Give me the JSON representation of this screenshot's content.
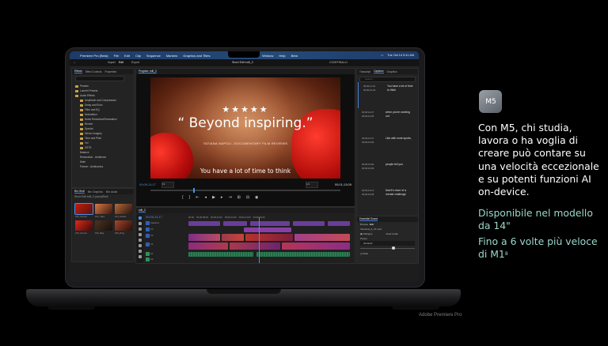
{
  "menubar": {
    "app": "Premiere Pro (Beta)",
    "items": [
      "File",
      "Edit",
      "Clip",
      "Sequence",
      "Markers",
      "Graphics and Titles",
      "View",
      "Window",
      "Help",
      "Beta"
    ],
    "clock": "Tue Oct 14  9:41 AM"
  },
  "app_header": {
    "tabs": [
      "Import",
      "Edit",
      "Export"
    ],
    "title": "Short Edit edit_3",
    "right": "CODEFINALv1"
  },
  "effects_panel": {
    "tabs": [
      "Effects",
      "Effect Controls",
      "Properties"
    ],
    "tree": [
      "Presets",
      "Lumetri Presets",
      "Audio Effects",
      "Amplitude and Compression",
      "Delay and Echo",
      "Filter and EQ",
      "Modulation",
      "Noise Reduction/Restoration",
      "Reverb",
      "Special",
      "Stereo Imagery",
      "Time and Pitch",
      "Vol",
      "VSTS",
      "Balance",
      "Restoration - Ambience",
      "Mute",
      "Panner - Ambisonics"
    ]
  },
  "bin_panel": {
    "tabs": [
      "Bin: Broll",
      "Bin: Graphics",
      "Bin: Audio"
    ],
    "path": "Short Edit edit_3 prproj/Broll",
    "clips": [
      "100_Gloves",
      "102_Tape",
      "104_Hands",
      "105_Gloves",
      "106_Bag",
      "109_Ring"
    ]
  },
  "program_monitor": {
    "title": "Program: edit_3",
    "stars": "★★★★★",
    "quote": "“ Beyond inspiring.”",
    "reviewer": "TATIANA NAPOLI, DOCUMENTARY FILM REVIEWS",
    "caption": "You have a lot of time to think",
    "timecode_left": "00;00;11;17",
    "fit": "Fit",
    "zoom": "1/2",
    "timecode_right": "00;01;13;09"
  },
  "captions_panel": {
    "tabs": [
      "Text",
      "Transcript",
      "Captions",
      "Graphics",
      "Sel"
    ],
    "search_placeholder": "Search",
    "items": [
      {
        "in": "00;00;11;15",
        "out": "00;00;12;23",
        "text": "You have a lot of time to think"
      },
      {
        "in": "00;00;12;27",
        "out": "00;00;14;25",
        "text": "when you're working out"
      },
      {
        "in": "00;00;14;27",
        "out": "00;00;15;00",
        "text": "Like with most sports,"
      },
      {
        "in": "00;00;15;00",
        "out": "00;00;16;09",
        "text": "people tell you"
      },
      {
        "in": "00;00;16;14",
        "out": "00;00;18;08",
        "text": "that it's more of a mental challenge"
      }
    ]
  },
  "essential_sound": {
    "title": "Essential Sound",
    "tabs": [
      "Browse",
      "Edit"
    ],
    "clip": "Interview_0_37.mp4",
    "rows": [
      "Dialogue",
      "Clear Audio",
      "Preset",
      "(Default)",
      "Mute"
    ]
  },
  "timeline": {
    "title": "edit_3",
    "timecode": "00;00;11;17",
    "ruler": [
      "00;00",
      "00;00;08;00",
      "00;00;10;00",
      "00;00;12;00",
      "00;00;14;00",
      "00;00;16;00",
      "00;00;18;00",
      "00;00;20;00"
    ],
    "tracks": [
      "V3",
      "V2",
      "V1",
      "A1",
      "A2",
      "A3"
    ],
    "caption_track": "Captions"
  },
  "promo": {
    "badge": "M5",
    "body": "Con M5, chi studia, lavora o ha voglia di creare può contare su una velocità eccezionale e su potenti funzioni AI on-device.",
    "highlight1": "Disponibile nel modello da 14\"",
    "highlight2": "Fino a 6 volte più veloce di M1",
    "footnote_mark": "8",
    "footer": "Adobe Premiere Pro"
  },
  "colors": {
    "accent_blue": "#4a8ff0",
    "highlight_teal": "#9bd8c9",
    "glove_red": "#c8100f"
  }
}
